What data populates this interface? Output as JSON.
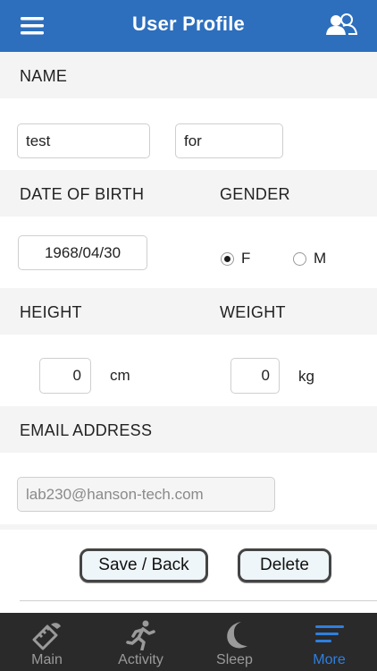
{
  "header": {
    "title": "User Profile",
    "menu_icon": "hamburger-menu-icon",
    "users_icon": "users-icon"
  },
  "sections": {
    "name_label": "NAME",
    "dob_label": "DATE OF BIRTH",
    "gender_label": "GENDER",
    "height_label": "HEIGHT",
    "weight_label": "WEIGHT",
    "email_label": "EMAIL ADDRESS"
  },
  "form": {
    "first_name": "test",
    "last_name": "for",
    "dob": "1968/04/30",
    "gender_options": [
      "F",
      "M"
    ],
    "gender_selected": "F",
    "height_value": "0",
    "height_unit": "cm",
    "weight_value": "0",
    "weight_unit": "kg",
    "email": "lab230@hanson-tech.com"
  },
  "buttons": {
    "save_back": "Save / Back",
    "delete": "Delete"
  },
  "tabs": [
    {
      "label": "Main",
      "icon": "ruler-shoe-icon",
      "active": false
    },
    {
      "label": "Activity",
      "icon": "running-person-icon",
      "active": false
    },
    {
      "label": "Sleep",
      "icon": "moon-icon",
      "active": false
    },
    {
      "label": "More",
      "icon": "more-lines-icon",
      "active": true
    }
  ],
  "colors": {
    "header_bg": "#2d6fbd",
    "tab_active": "#2f7fe0",
    "tab_inactive": "#9a9a9a",
    "tabbar_bg": "#2a2a2a"
  }
}
